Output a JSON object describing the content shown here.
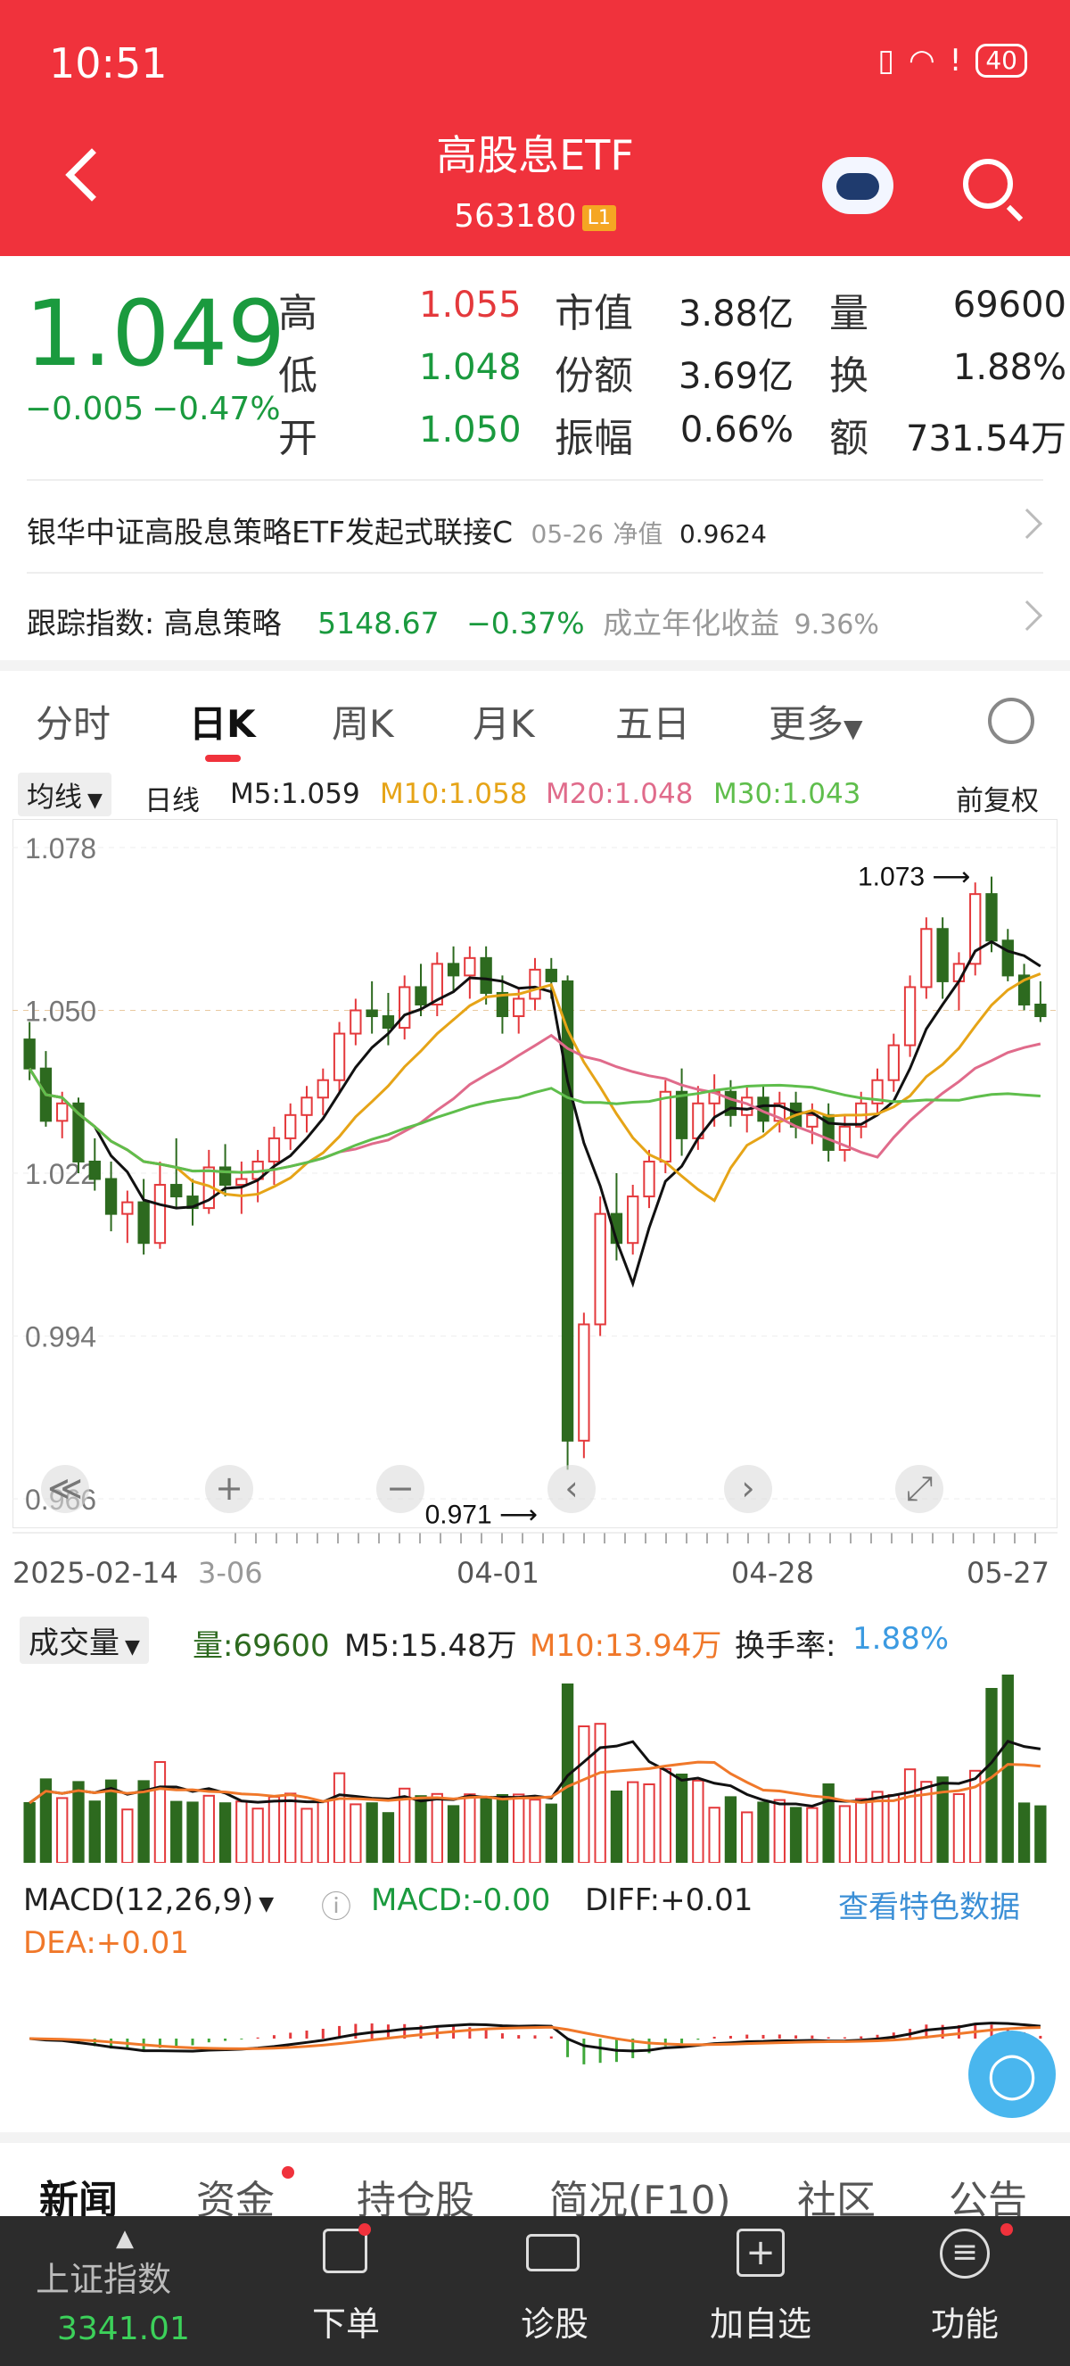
{
  "status": {
    "time": "10:51",
    "battery": "40"
  },
  "header": {
    "title": "高股息ETF",
    "code": "563180",
    "level": "L1"
  },
  "quote": {
    "price": "1.049",
    "change": "−0.005",
    "change_pct": "−0.47%",
    "rows": [
      [
        {
          "label": "高",
          "value": "1.055",
          "color": "red"
        },
        {
          "label": "市值",
          "value": "3.88亿"
        },
        {
          "label": "量",
          "value": "69600"
        }
      ],
      [
        {
          "label": "低",
          "value": "1.048",
          "color": "green"
        },
        {
          "label": "份额",
          "value": "3.69亿"
        },
        {
          "label": "换",
          "value": "1.88%"
        }
      ],
      [
        {
          "label": "开",
          "value": "1.050",
          "color": "green"
        },
        {
          "label": "振幅",
          "value": "0.66%"
        },
        {
          "label": "额",
          "value": "731.54万"
        }
      ]
    ]
  },
  "fund": {
    "name": "银华中证高股息策略ETF发起式联接C",
    "date": "05-26",
    "nav_label": "净值",
    "nav": "0.9624"
  },
  "index": {
    "label": "跟踪指数: 高息策略",
    "value": "5148.67",
    "pct": "−0.37%",
    "ret_label": "成立年化收益",
    "ret": "9.36%"
  },
  "tabs": [
    "分时",
    "日K",
    "周K",
    "月K",
    "五日",
    "更多"
  ],
  "ma_bar": {
    "sel": "均线",
    "period": "日线",
    "m5": "M5:1.059",
    "m10": "M10:1.058",
    "m20": "M20:1.048",
    "m30": "M30:1.043",
    "adj": "前复权"
  },
  "chart_data": {
    "type": "candlestick",
    "yticks": [
      "1.078",
      "1.050",
      "1.022",
      "0.994",
      "0.966"
    ],
    "xticks": [
      "2025-02-14",
      "3-06",
      "04-01",
      "04-28",
      "05-27"
    ],
    "high_mark": "1.073",
    "low_mark": "0.971",
    "ylim": [
      0.966,
      1.078
    ],
    "ohlc": [
      [
        1.045,
        1.048,
        1.038,
        1.04
      ],
      [
        1.04,
        1.043,
        1.03,
        1.031
      ],
      [
        1.031,
        1.036,
        1.028,
        1.034
      ],
      [
        1.034,
        1.035,
        1.022,
        1.024
      ],
      [
        1.024,
        1.028,
        1.019,
        1.021
      ],
      [
        1.021,
        1.024,
        1.012,
        1.015
      ],
      [
        1.015,
        1.019,
        1.01,
        1.017
      ],
      [
        1.017,
        1.021,
        1.008,
        1.01
      ],
      [
        1.01,
        1.024,
        1.009,
        1.02
      ],
      [
        1.02,
        1.028,
        1.016,
        1.018
      ],
      [
        1.018,
        1.021,
        1.013,
        1.016
      ],
      [
        1.016,
        1.026,
        1.015,
        1.023
      ],
      [
        1.023,
        1.027,
        1.018,
        1.02
      ],
      [
        1.02,
        1.024,
        1.015,
        1.021
      ],
      [
        1.021,
        1.026,
        1.017,
        1.024
      ],
      [
        1.024,
        1.03,
        1.02,
        1.028
      ],
      [
        1.028,
        1.034,
        1.026,
        1.032
      ],
      [
        1.032,
        1.037,
        1.029,
        1.035
      ],
      [
        1.035,
        1.04,
        1.032,
        1.038
      ],
      [
        1.038,
        1.048,
        1.036,
        1.046
      ],
      [
        1.046,
        1.052,
        1.044,
        1.05
      ],
      [
        1.05,
        1.055,
        1.046,
        1.049
      ],
      [
        1.049,
        1.053,
        1.044,
        1.047
      ],
      [
        1.047,
        1.056,
        1.045,
        1.054
      ],
      [
        1.054,
        1.058,
        1.049,
        1.051
      ],
      [
        1.051,
        1.06,
        1.049,
        1.058
      ],
      [
        1.058,
        1.061,
        1.053,
        1.056
      ],
      [
        1.056,
        1.061,
        1.052,
        1.059
      ],
      [
        1.059,
        1.061,
        1.051,
        1.053
      ],
      [
        1.053,
        1.056,
        1.046,
        1.049
      ],
      [
        1.049,
        1.054,
        1.046,
        1.052
      ],
      [
        1.052,
        1.059,
        1.05,
        1.057
      ],
      [
        1.057,
        1.059,
        1.052,
        1.055
      ],
      [
        1.055,
        1.056,
        0.971,
        0.976
      ],
      [
        0.976,
        0.998,
        0.973,
        0.996
      ],
      [
        0.996,
        1.018,
        0.994,
        1.015
      ],
      [
        1.015,
        1.022,
        1.007,
        1.01
      ],
      [
        1.01,
        1.02,
        1.008,
        1.018
      ],
      [
        1.018,
        1.026,
        1.016,
        1.024
      ],
      [
        1.024,
        1.038,
        1.022,
        1.036
      ],
      [
        1.036,
        1.04,
        1.025,
        1.028
      ],
      [
        1.028,
        1.037,
        1.026,
        1.034
      ],
      [
        1.034,
        1.039,
        1.03,
        1.036
      ],
      [
        1.036,
        1.038,
        1.03,
        1.032
      ],
      [
        1.032,
        1.037,
        1.029,
        1.035
      ],
      [
        1.035,
        1.037,
        1.029,
        1.031
      ],
      [
        1.031,
        1.036,
        1.029,
        1.034
      ],
      [
        1.034,
        1.036,
        1.028,
        1.03
      ],
      [
        1.03,
        1.034,
        1.027,
        1.032
      ],
      [
        1.032,
        1.034,
        1.024,
        1.026
      ],
      [
        1.026,
        1.032,
        1.024,
        1.03
      ],
      [
        1.03,
        1.036,
        1.028,
        1.034
      ],
      [
        1.034,
        1.04,
        1.032,
        1.038
      ],
      [
        1.038,
        1.046,
        1.036,
        1.044
      ],
      [
        1.044,
        1.056,
        1.042,
        1.054
      ],
      [
        1.054,
        1.066,
        1.052,
        1.064
      ],
      [
        1.064,
        1.066,
        1.052,
        1.055
      ],
      [
        1.055,
        1.06,
        1.05,
        1.058
      ],
      [
        1.058,
        1.072,
        1.056,
        1.07
      ],
      [
        1.07,
        1.073,
        1.06,
        1.062
      ],
      [
        1.062,
        1.064,
        1.055,
        1.056
      ],
      [
        1.056,
        1.058,
        1.05,
        1.051
      ],
      [
        1.051,
        1.055,
        1.048,
        1.049
      ]
    ]
  },
  "controls": [
    "≪",
    "+",
    "−",
    "‹",
    "›",
    "⤢"
  ],
  "volume": {
    "sel": "成交量",
    "vol": "量:69600",
    "m5": "M5:15.48万",
    "m10": "M10:13.94万",
    "turnover_label": "换手率:",
    "turnover": "1.88%"
  },
  "macd": {
    "sel": "MACD(12,26,9)",
    "macd": "MACD:-0.00",
    "diff": "DIFF:+0.01",
    "dea": "DEA:+0.01",
    "link": "查看特色数据"
  },
  "news_tabs": [
    "新闻",
    "资金",
    "持仓股",
    "简况(F10)",
    "社区",
    "公告"
  ],
  "nav": {
    "index_name": "上证指数",
    "index_value": "3341.01",
    "items": [
      "下单",
      "诊股",
      "加自选",
      "功能"
    ]
  }
}
